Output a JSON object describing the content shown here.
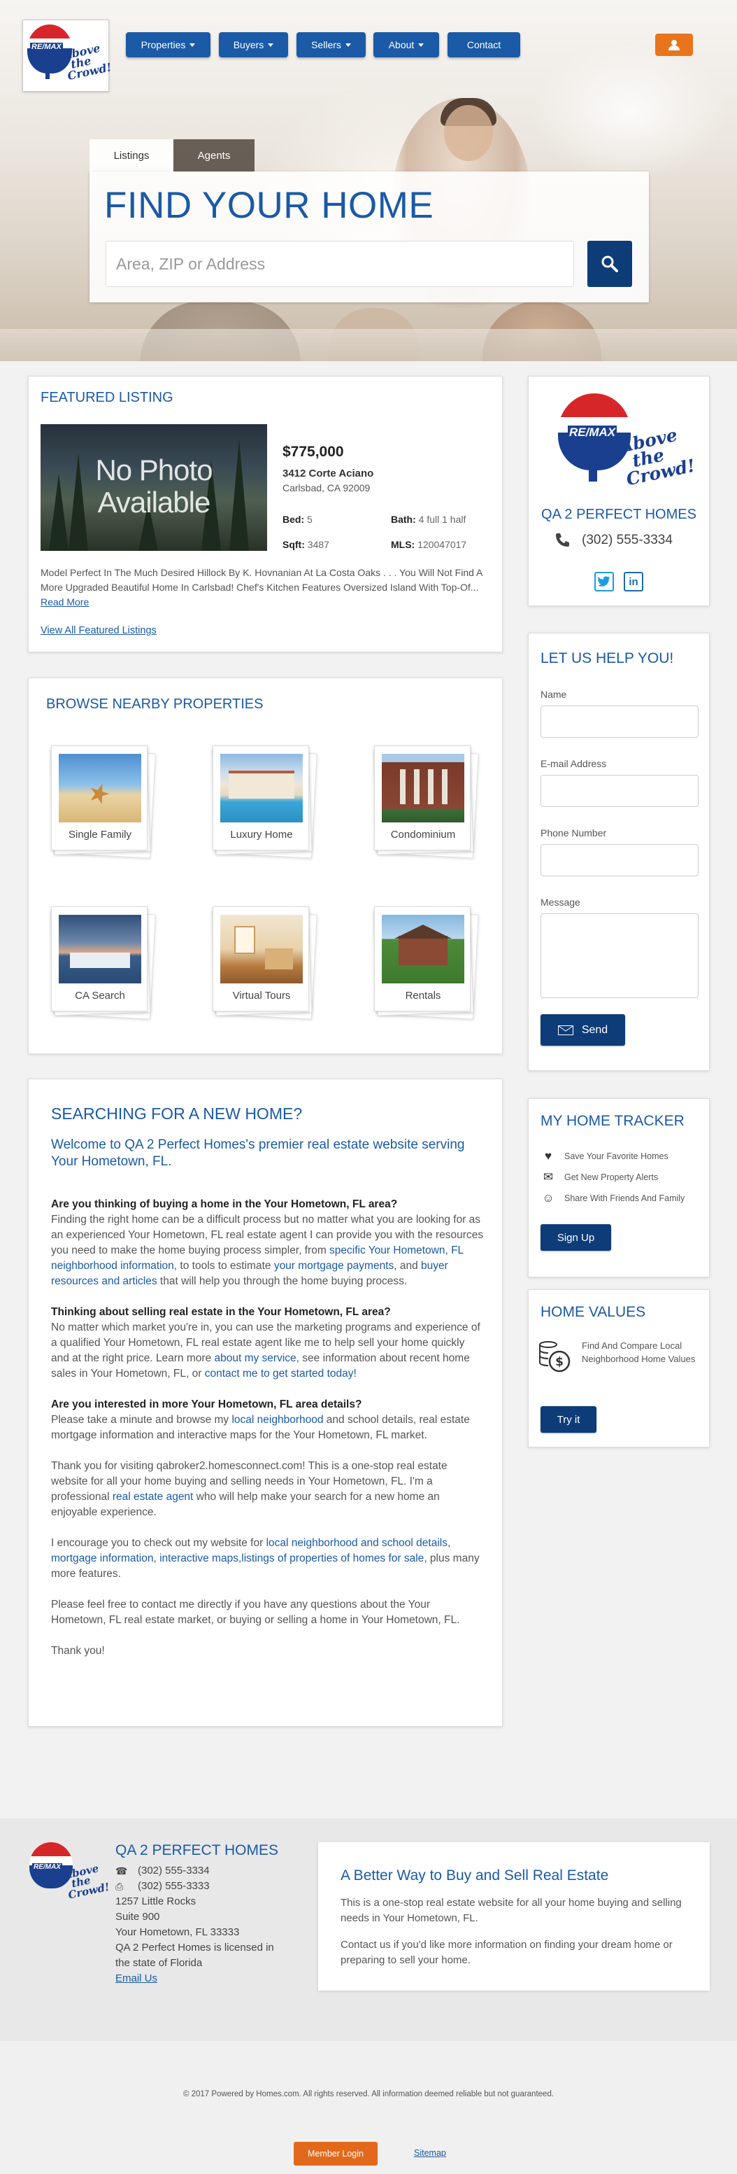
{
  "brand": {
    "logo_line1": "Above",
    "logo_line2": "the",
    "logo_line3": "Crowd!",
    "logo_remax": "RE/MAX",
    "colors": {
      "blue": "#1a5aa6",
      "dark_blue": "#0d3c78",
      "orange": "#e8741c",
      "red": "#d7262a"
    }
  },
  "nav": {
    "items": [
      {
        "label": "Properties",
        "dropdown": true
      },
      {
        "label": "Buyers",
        "dropdown": true
      },
      {
        "label": "Sellers",
        "dropdown": true
      },
      {
        "label": "About",
        "dropdown": true
      },
      {
        "label": "Contact",
        "dropdown": false
      }
    ],
    "user_icon": "user-icon"
  },
  "search": {
    "tabs": [
      "Listings",
      "Agents"
    ],
    "active_tab": "Listings",
    "title": "FIND YOUR HOME",
    "placeholder": "Area, ZIP or Address",
    "button_icon": "search-icon"
  },
  "featured": {
    "title": "FEATURED LISTING",
    "no_photo_line1": "No Photo",
    "no_photo_line2": "Available",
    "price": "$775,000",
    "address": "3412 Corte Aciano",
    "city": "Carlsbad, CA 92009",
    "bed_label": "Bed:",
    "bed": "5",
    "bath_label": "Bath:",
    "bath": "4 full 1 half",
    "sqft_label": "Sqft:",
    "sqft": "3487",
    "mls_label": "MLS:",
    "mls": "120047017",
    "description": "Model Perfect In The Much Desired Hillock By K. Hovnanian At La Costa Oaks . . . You Will Not Find A More Upgraded Beautiful Home In Carlsbad! Chef's Kitchen Features Oversized Island With Top-Of...",
    "read_more": "Read More",
    "view_all": "View All Featured Listings"
  },
  "browse": {
    "title": "BROWSE NEARBY PROPERTIES",
    "tiles": [
      {
        "label": "Single Family"
      },
      {
        "label": "Luxury Home"
      },
      {
        "label": "Condominium"
      },
      {
        "label": "CA Search"
      },
      {
        "label": "Virtual Tours"
      },
      {
        "label": "Rentals"
      }
    ]
  },
  "article": {
    "title": "SEARCHING FOR A NEW HOME?",
    "subtitle": "Welcome to QA 2 Perfect Homes's premier real estate website serving Your Hometown, FL.",
    "h1": "Are you thinking of buying a home in the Your Hometown, FL area?",
    "p1a": "Finding the right home can be a difficult process but no matter what you are looking for as an experienced Your Hometown, FL real estate agent I can provide you with the resources you need to make the home buying process simpler, from ",
    "p1_link1": "specific Your Hometown, FL neighborhood information",
    "p1b": ", to tools to estimate ",
    "p1_link2": "your mortgage payments",
    "p1c": ", and ",
    "p1_link3": "buyer resources and articles",
    "p1d": " that will help you through the home buying process.",
    "h2": "Thinking about selling real estate in the Your Hometown, FL area?",
    "p2a": "No matter which market you're in, you can use the marketing programs and experience of a qualified Your Hometown, FL real estate agent like me to help sell your home quickly and at the right price. Learn more ",
    "p2_link1": "about my service",
    "p2b": ", see information about recent home sales in Your Hometown, FL, or ",
    "p2_link2": "contact me to get started today!",
    "h3": "Are you interested in more Your Hometown, FL area details?",
    "p3a": "Please take a minute and browse my ",
    "p3_link1": "local neighborhood",
    "p3b": " and school details, real estate mortgage information and interactive maps for the Your Hometown, FL market.",
    "p4a": "Thank you for visiting qabroker2.homesconnect.com! This is a one-stop real estate website for all your home buying and selling needs in Your Hometown, FL. I'm a professional ",
    "p4_link1": "real estate agent",
    "p4b": " who will help make your search for a new home an enjoyable experience.",
    "p5a": "I encourage you to check out my website for ",
    "p5_link1": "local neighborhood and school details",
    "p5b": ", ",
    "p5_link2": "mortgage information",
    "p5c": ", ",
    "p5_link3": "interactive maps",
    "p5d": ",",
    "p5_link4": "listings of properties of homes for sale",
    "p5e": ", plus many more features.",
    "p6": "Please feel free to contact me directly if you have any questions about the Your Hometown, FL real estate market, or buying or selling a home in Your Hometown, FL.",
    "p7": "Thank you!"
  },
  "agent_card": {
    "name": "QA 2 PERFECT HOMES",
    "phone": "(302) 555-3334",
    "twitter_icon": "twitter-icon",
    "linkedin_icon": "linkedin-icon"
  },
  "contact_form": {
    "title": "LET US HELP YOU!",
    "name_label": "Name",
    "email_label": "E-mail Address",
    "phone_label": "Phone Number",
    "message_label": "Message",
    "send_label": "Send"
  },
  "tracker": {
    "title": "MY HOME TRACKER",
    "items": [
      "Save Your Favorite Homes",
      "Get New Property Alerts",
      "Share With Friends And Family"
    ],
    "button": "Sign Up"
  },
  "home_values": {
    "title": "HOME VALUES",
    "text": "Find And Compare Local Neighborhood Home Values",
    "button": "Try it"
  },
  "footer": {
    "company": "QA 2 PERFECT HOMES",
    "phone1": "(302) 555-3334",
    "phone2": "(302) 555-3333",
    "addr1": "1257 Little Rocks",
    "addr2": "Suite 900",
    "addr3": "Your Hometown, FL 33333",
    "license": "QA 2 Perfect Homes is licensed in the state of Florida",
    "email": "Email Us",
    "promo_title": "A Better Way to Buy and Sell Real Estate",
    "promo_p1": "This is a one-stop real estate website for all your home buying and selling needs in Your Hometown, FL.",
    "promo_p2": "Contact us if you'd like more information on finding your dream home or preparing to sell your home.",
    "copyright": "© 2017 Powered by Homes.com. All rights reserved. All information deemed reliable but not guaranteed.",
    "member_login": "Member Login",
    "sitemap": "Sitemap"
  }
}
